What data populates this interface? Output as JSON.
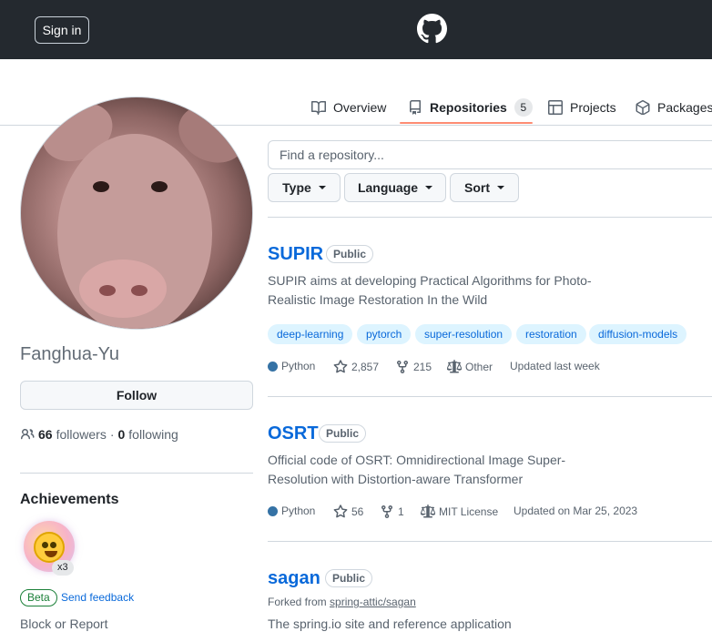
{
  "header": {
    "sign_in": "Sign in"
  },
  "tabs": [
    {
      "label": "Overview",
      "icon": "book-icon"
    },
    {
      "label": "Repositories",
      "icon": "repo-icon",
      "count": "5",
      "active": true
    },
    {
      "label": "Projects",
      "icon": "table-icon"
    },
    {
      "label": "Packages",
      "icon": "package-icon"
    }
  ],
  "profile": {
    "username": "Fanghua-Yu",
    "follow": "Follow",
    "followers_count": "66",
    "followers_label": "followers",
    "separator": "·",
    "following_count": "0",
    "following_label": "following",
    "achievements_title": "Achievements",
    "achievement_count": "x3",
    "beta": "Beta",
    "feedback": "Send feedback",
    "block": "Block or Report"
  },
  "search": {
    "placeholder": "Find a repository..."
  },
  "filters": [
    "Type",
    "Language",
    "Sort"
  ],
  "colors": {
    "python": "#3572a5",
    "link": "#0969da",
    "header_bg": "#24292f",
    "tab_underline": "#fd8c73"
  },
  "repos": [
    {
      "name": "SUPIR",
      "visibility": "Public",
      "description": "SUPIR aims at developing Practical Algorithms for Photo-Realistic Image Restoration In the Wild",
      "topics": [
        "deep-learning",
        "pytorch",
        "super-resolution",
        "restoration",
        "diffusion-models"
      ],
      "language": "Python",
      "stars": "2,857",
      "forks": "215",
      "license": "Other",
      "updated": "Updated last week"
    },
    {
      "name": "OSRT",
      "visibility": "Public",
      "description": "Official code of OSRT: Omnidirectional Image Super-Resolution with Distortion-aware Transformer",
      "language": "Python",
      "stars": "56",
      "forks": "1",
      "license": "MIT License",
      "updated": "Updated on Mar 25, 2023"
    },
    {
      "name": "sagan",
      "visibility": "Public",
      "forked_prefix": "Forked from",
      "forked_from": "spring-attic/sagan",
      "description": "The spring.io site and reference application"
    }
  ]
}
